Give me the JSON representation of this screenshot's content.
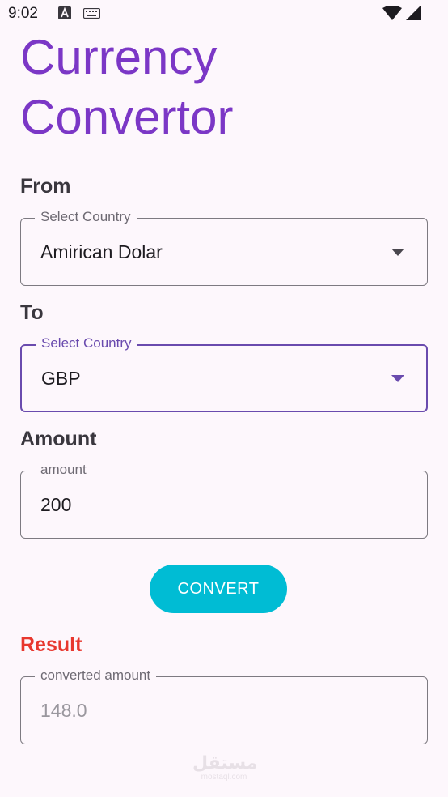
{
  "status_bar": {
    "time": "9:02",
    "icons": [
      "a-badge-icon",
      "keyboard-icon",
      "wifi-icon",
      "signal-icon"
    ]
  },
  "title": {
    "line1": "Currency",
    "line2": "Convertor",
    "color": "#7b37c6"
  },
  "from": {
    "label": "From",
    "field_label": "Select Country",
    "value": "Amirican Dolar"
  },
  "to": {
    "label": "To",
    "field_label": "Select Country",
    "value": "GBP"
  },
  "amount": {
    "label": "Amount",
    "field_label": "amount",
    "value": "200"
  },
  "convert_button": {
    "label": "CONVERT",
    "color": "#00bcd4"
  },
  "result": {
    "label": "Result",
    "field_label": "converted amount",
    "value": "148.0",
    "label_color": "#e8372e"
  },
  "watermark": {
    "text": "مستقل",
    "subtext": "mostaql.com"
  }
}
